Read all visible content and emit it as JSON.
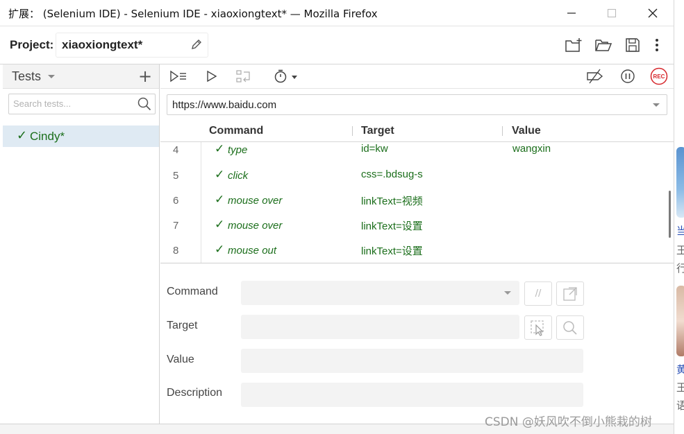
{
  "window": {
    "title": "扩展：  (Selenium IDE) - Selenium IDE - xiaoxiongtext* — Mozilla Firefox"
  },
  "project": {
    "label": "Project:",
    "name": "xiaoxiongtext*"
  },
  "sidebar": {
    "header": "Tests",
    "search_placeholder": "Search tests...",
    "tests": [
      {
        "check": "✓",
        "name": "Cindy*"
      }
    ]
  },
  "toolbar": {
    "record_label": "REC"
  },
  "base_url": "https://www.baidu.com",
  "grid": {
    "headers": {
      "command": "Command",
      "target": "Target",
      "value": "Value"
    },
    "rows": [
      {
        "num": "4",
        "check": "✓",
        "command": "type",
        "target": "id=kw",
        "value": "wangxin"
      },
      {
        "num": "5",
        "check": "✓",
        "command": "click",
        "target": "css=.bdsug-s",
        "value": ""
      },
      {
        "num": "6",
        "check": "✓",
        "command": "mouse over",
        "target": "linkText=视频",
        "value": ""
      },
      {
        "num": "7",
        "check": "✓",
        "command": "mouse over",
        "target": "linkText=设置",
        "value": ""
      },
      {
        "num": "8",
        "check": "✓",
        "command": "mouse out",
        "target": "linkText=设置",
        "value": ""
      }
    ]
  },
  "editor": {
    "command_label": "Command",
    "target_label": "Target",
    "value_label": "Value",
    "description_label": "Description",
    "comment_toggle": "//"
  },
  "watermark": "CSDN @妖风吹不倒小熊栽的树",
  "colors": {
    "pass_green": "#1b6e1b",
    "rec_red": "#d6262b",
    "selected_test_bg": "#dfeaf3"
  }
}
